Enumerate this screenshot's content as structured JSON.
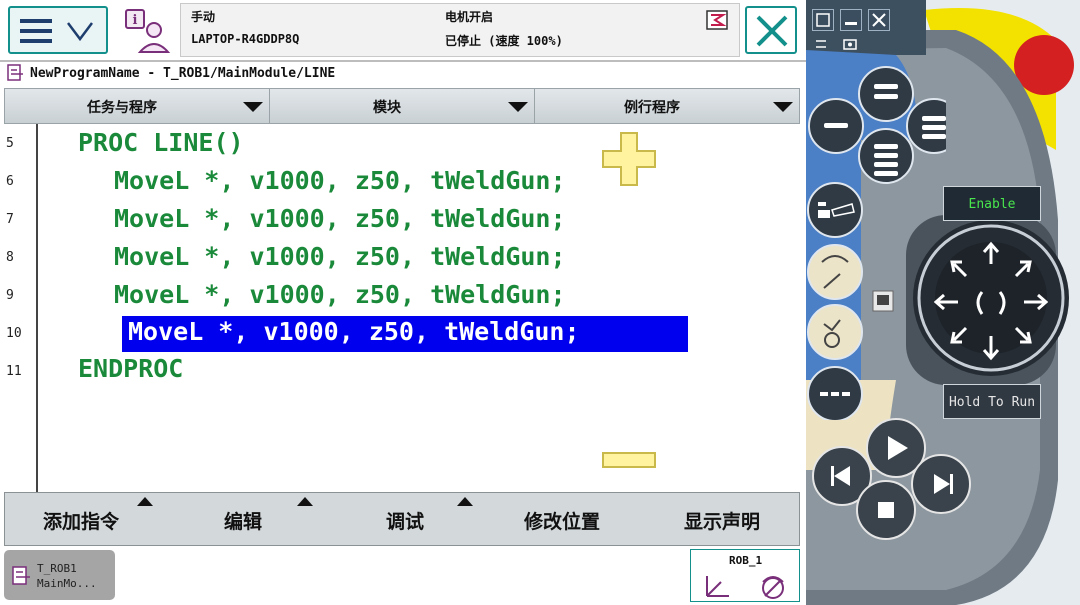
{
  "header": {
    "mode": "手动",
    "controller": "LAPTOP-R4GDDP8Q",
    "motor_state": "电机开启",
    "run_state": "已停止 (速度 100%)"
  },
  "path": "NewProgramName - T_ROB1/MainModule/LINE",
  "tabs": [
    {
      "label": "任务与程序"
    },
    {
      "label": "模块"
    },
    {
      "label": "例行程序"
    }
  ],
  "code_lines": [
    {
      "num": "5",
      "text": "PROC LINE()"
    },
    {
      "num": "6",
      "text": "MoveL *, v1000, z50, tWeldGun;"
    },
    {
      "num": "7",
      "text": "MoveL *, v1000, z50, tWeldGun;"
    },
    {
      "num": "8",
      "text": "MoveL *, v1000, z50, tWeldGun;"
    },
    {
      "num": "9",
      "text": "MoveL *, v1000, z50, tWeldGun;"
    },
    {
      "num": "10",
      "text": "MoveL *, v1000, z50, tWeldGun;"
    },
    {
      "num": "11",
      "text": "ENDPROC"
    }
  ],
  "commands": [
    {
      "label": "添加指令"
    },
    {
      "label": "编辑"
    },
    {
      "label": "调试"
    },
    {
      "label": "修改位置"
    },
    {
      "label": "显示声明"
    }
  ],
  "task_button": {
    "line1": "T_ROB1",
    "line2": "MainMo..."
  },
  "robot_button": {
    "label": "ROB_1"
  },
  "pendant": {
    "enable_label": "Enable",
    "hold_to_run_label": "Hold To Run"
  },
  "colors": {
    "accent": "#13908b",
    "code_green": "#1a8a3a",
    "selection": "#0000ee",
    "zoom_yellow": "#fff3a0"
  }
}
